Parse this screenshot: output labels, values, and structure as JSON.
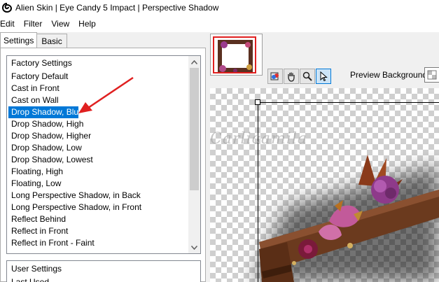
{
  "window": {
    "title": "Alien Skin | Eye Candy 5 Impact | Perspective Shadow"
  },
  "menu": [
    "Edit",
    "Filter",
    "View",
    "Help"
  ],
  "tabs": [
    {
      "label": "Settings",
      "active": true
    },
    {
      "label": "Basic",
      "active": false
    }
  ],
  "factory": {
    "header": "Factory Settings",
    "items": [
      "Factory Default",
      "Cast in Front",
      "Cast on Wall",
      "Drop Shadow, Blurry",
      "Drop Shadow, High",
      "Drop Shadow, Higher",
      "Drop Shadow, Low",
      "Drop Shadow, Lowest",
      "Floating, High",
      "Floating, Low",
      "Long Perspective Shadow, in Back",
      "Long Perspective Shadow, in Front",
      "Reflect Behind",
      "Reflect in Front",
      "Reflect in Front - Faint"
    ],
    "selected_index": 3
  },
  "user": {
    "header": "User Settings",
    "partial_item": "Last Used"
  },
  "toolbar": {
    "tools": [
      "preview-toggle-icon",
      "hand-icon",
      "zoom-icon",
      "pointer-icon"
    ],
    "active_tool": "pointer-icon"
  },
  "preview": {
    "background_label": "Preview Background:",
    "watermark": "Carlicamila"
  },
  "colors": {
    "selection": "#0078d7",
    "annotation_arrow": "#e02020",
    "wood": "#6b3a1e",
    "flower": "#8e3a8a"
  }
}
